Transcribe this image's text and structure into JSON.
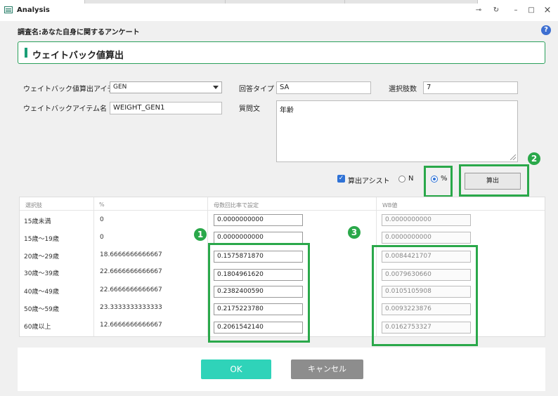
{
  "window": {
    "title": "Analysis",
    "controls": {
      "pin": "⊸",
      "restore_alt": "↻",
      "minimize": "–",
      "maximize": "□",
      "close": "×"
    }
  },
  "header": {
    "survey_label": "調査名:あなた自身に関するアンケート",
    "help": "?"
  },
  "section": {
    "title": "ウェイトバック値算出"
  },
  "form": {
    "item_label": "ウェイトバック値算出アイテム",
    "item_value": "GEN",
    "answer_type_label": "回答タイプ",
    "answer_type_value": "SA",
    "choices_label": "選択肢数",
    "choices_value": "7",
    "wb_item_label": "ウェイトバックアイテム名",
    "wb_item_value": "WEIGHT_GEN1",
    "question_label": "質問文",
    "question_value": "年齢"
  },
  "assist": {
    "checkbox_label": "算出アシスト",
    "checkbox_checked": true,
    "radio_n_label": "N",
    "radio_pct_label": "%",
    "selected": "%",
    "calc_button": "算出"
  },
  "annotations": {
    "badge1": "1",
    "badge2": "2",
    "badge3": "3",
    "color": "#2aa84a"
  },
  "table": {
    "headers": [
      "選択肢",
      "%",
      "母数回比率で設定",
      "WB値"
    ],
    "rows": [
      {
        "choice": "15歳未満",
        "pct": "0",
        "ratio": "0.0000000000",
        "wb": "0.0000000000"
      },
      {
        "choice": "15歳～19歳",
        "pct": "0",
        "ratio": "0.0000000000",
        "wb": "0.0000000000"
      },
      {
        "choice": "20歳～29歳",
        "pct": "18.6666666666667",
        "ratio": "0.1575871870",
        "wb": "0.0084421707"
      },
      {
        "choice": "30歳～39歳",
        "pct": "22.6666666666667",
        "ratio": "0.1804961620",
        "wb": "0.0079630660"
      },
      {
        "choice": "40歳～49歳",
        "pct": "22.6666666666667",
        "ratio": "0.2382400590",
        "wb": "0.0105105908"
      },
      {
        "choice": "50歳～59歳",
        "pct": "23.3333333333333",
        "ratio": "0.2175223780",
        "wb": "0.0093223876"
      },
      {
        "choice": "60歳以上",
        "pct": "12.6666666666667",
        "ratio": "0.2061542140",
        "wb": "0.0162753327"
      }
    ]
  },
  "footer": {
    "ok": "OK",
    "cancel": "キャンセル"
  }
}
